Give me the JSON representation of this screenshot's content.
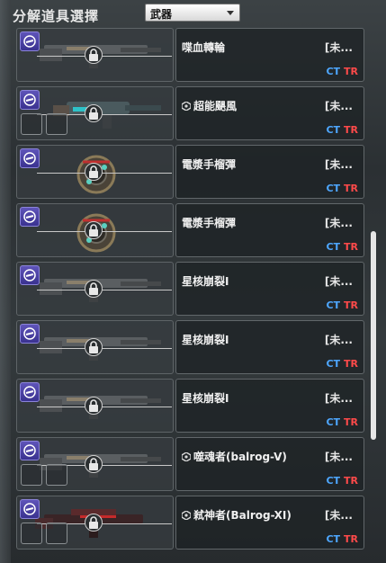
{
  "header": {
    "title": "分解道具選擇",
    "filter_value": "武器"
  },
  "colors": {
    "ct": "#4ea7ff",
    "tr": "#ff4a4a",
    "badge": "#5f54b9"
  },
  "items": [
    {
      "name": "喋血轉輪",
      "status": "[未...",
      "ct": "CT",
      "tr": "TR",
      "has_gem": false,
      "slots": 0,
      "weapon_icon": "rifle-icon"
    },
    {
      "name": "超能颶風",
      "status": "[未...",
      "ct": "CT",
      "tr": "TR",
      "has_gem": true,
      "slots": 2,
      "weapon_icon": "smg-icon"
    },
    {
      "name": "電漿手榴彈",
      "status": "[未...",
      "ct": "CT",
      "tr": "TR",
      "has_gem": false,
      "slots": 0,
      "weapon_icon": "grenade-icon"
    },
    {
      "name": "電漿手榴彈",
      "status": "[未...",
      "ct": "CT",
      "tr": "TR",
      "has_gem": false,
      "slots": 0,
      "weapon_icon": "grenade-icon"
    },
    {
      "name": "星核崩裂Ⅰ",
      "status": "[未...",
      "ct": "CT",
      "tr": "TR",
      "has_gem": false,
      "slots": 0,
      "weapon_icon": "rifle-icon"
    },
    {
      "name": "星核崩裂Ⅰ",
      "status": "[未...",
      "ct": "CT",
      "tr": "TR",
      "has_gem": false,
      "slots": 0,
      "weapon_icon": "rifle-icon"
    },
    {
      "name": "星核崩裂Ⅰ",
      "status": "[未...",
      "ct": "CT",
      "tr": "TR",
      "has_gem": false,
      "slots": 0,
      "weapon_icon": "rifle-icon"
    },
    {
      "name": "噬魂者(balrog-V)",
      "status": "[未...",
      "ct": "CT",
      "tr": "TR",
      "has_gem": true,
      "slots": 2,
      "weapon_icon": "rifle-icon"
    },
    {
      "name": "弒神者(Balrog-XI)",
      "status": "[未...",
      "ct": "CT",
      "tr": "TR",
      "has_gem": true,
      "slots": 2,
      "weapon_icon": "shotgun-icon"
    }
  ]
}
